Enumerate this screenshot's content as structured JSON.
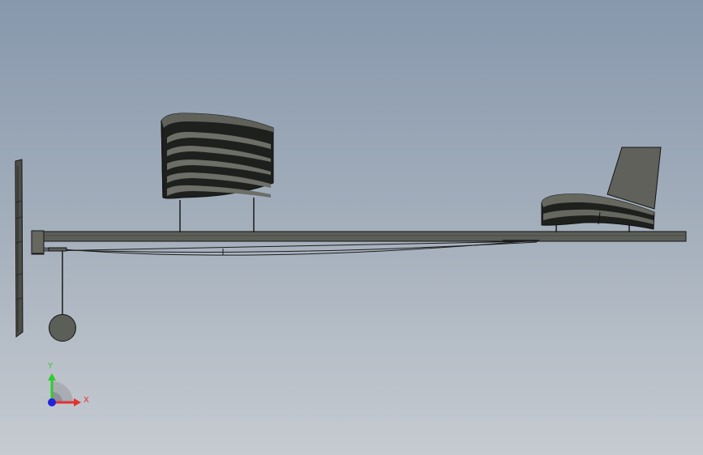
{
  "colors": {
    "background_top": "#8798ad",
    "background_bottom": "#c6cbd1",
    "body_fill": "#5c5e58",
    "dark_band": "#1c1e1b",
    "edge": "#151515",
    "axis_x": "#e53030",
    "axis_y": "#2ecc2e",
    "axis_z": "#2222dd"
  },
  "triad": {
    "x_label": "X",
    "y_label": "Y"
  },
  "icons": [
    "coordinate-triad-icon"
  ]
}
